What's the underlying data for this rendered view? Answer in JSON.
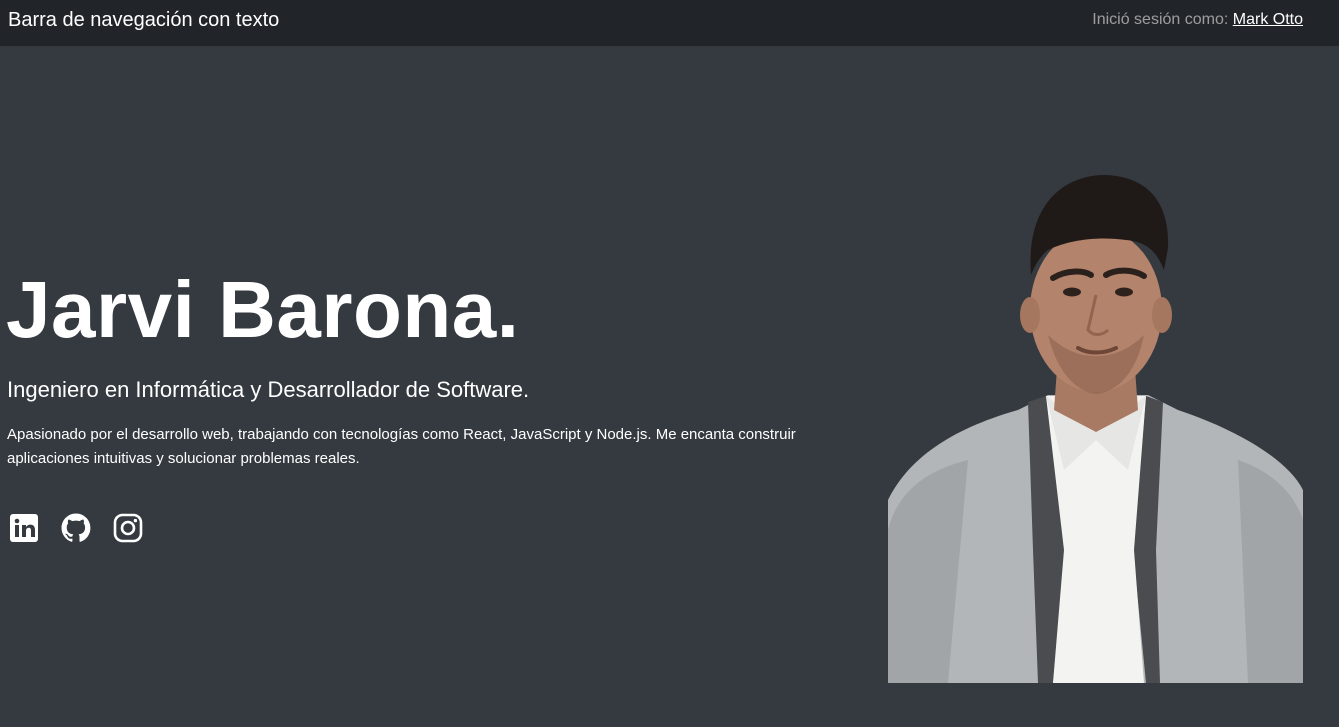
{
  "navbar": {
    "brand": "Barra de navegación con texto",
    "signed_in_prefix": "Inició sesión como: ",
    "user_name": "Mark Otto"
  },
  "hero": {
    "name": "Jarvi Barona.",
    "subtitle": "Ingeniero en Informática y Desarrollador de Software.",
    "description": "Apasionado por el desarrollo web, trabajando con tecnologías como React, JavaScript y Node.js. Me encanta construir aplicaciones intuitivas y solucionar problemas reales."
  },
  "social": [
    {
      "icon": "linkedin-icon"
    },
    {
      "icon": "github-icon"
    },
    {
      "icon": "instagram-icon"
    }
  ],
  "colors": {
    "navbar_bg": "#212529",
    "page_bg": "#343a40",
    "text": "#ffffff",
    "muted_text": "rgba(255,255,255,0.55)"
  }
}
